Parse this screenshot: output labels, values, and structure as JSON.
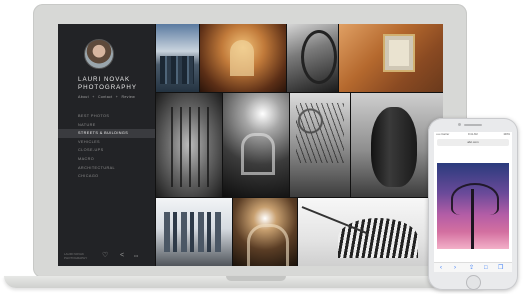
{
  "site": {
    "title_line1": "Lauri Novak",
    "title_line2": "Photography",
    "subnav": [
      "About",
      "+",
      "Contact",
      "+",
      "Review"
    ]
  },
  "nav": {
    "items": [
      {
        "label": "Best Photos",
        "active": false
      },
      {
        "label": "Nature",
        "active": false
      },
      {
        "label": "Streets & Buildings",
        "active": true
      },
      {
        "label": "Vehicles",
        "active": false
      },
      {
        "label": "Close-ups",
        "active": false
      },
      {
        "label": "Macro",
        "active": false
      },
      {
        "label": "Architectural",
        "active": false
      },
      {
        "label": "Chicago",
        "active": false
      }
    ]
  },
  "footer": {
    "copyright": "LAURI NOVAK PHOTOGRAPHY",
    "icons": [
      "heart-icon",
      "share-icon",
      "more-icon"
    ],
    "icon_glyphs": [
      "♡",
      "<",
      "•••"
    ]
  },
  "gallery": {
    "tiles": [
      "city-skyline",
      "ornate-hall",
      "arch-silhouette",
      "rustic-window",
      "cathedral-interior",
      "bridge-light",
      "trees-arches",
      "sculpture-heads",
      "skyscrapers",
      "tunnel-sunburst",
      "modern-museum"
    ]
  },
  "phone": {
    "carrier": "••••• Carrier",
    "time": "9:41 AM",
    "battery": "100%",
    "url": "abc.com",
    "toolbar_glyphs": [
      "‹",
      "›",
      "⇪",
      "□",
      "❐"
    ]
  },
  "colors": {
    "sidebar_bg": "#222326",
    "active_nav_bg": "#3a3b3f",
    "ios_blue": "#3478f6"
  }
}
